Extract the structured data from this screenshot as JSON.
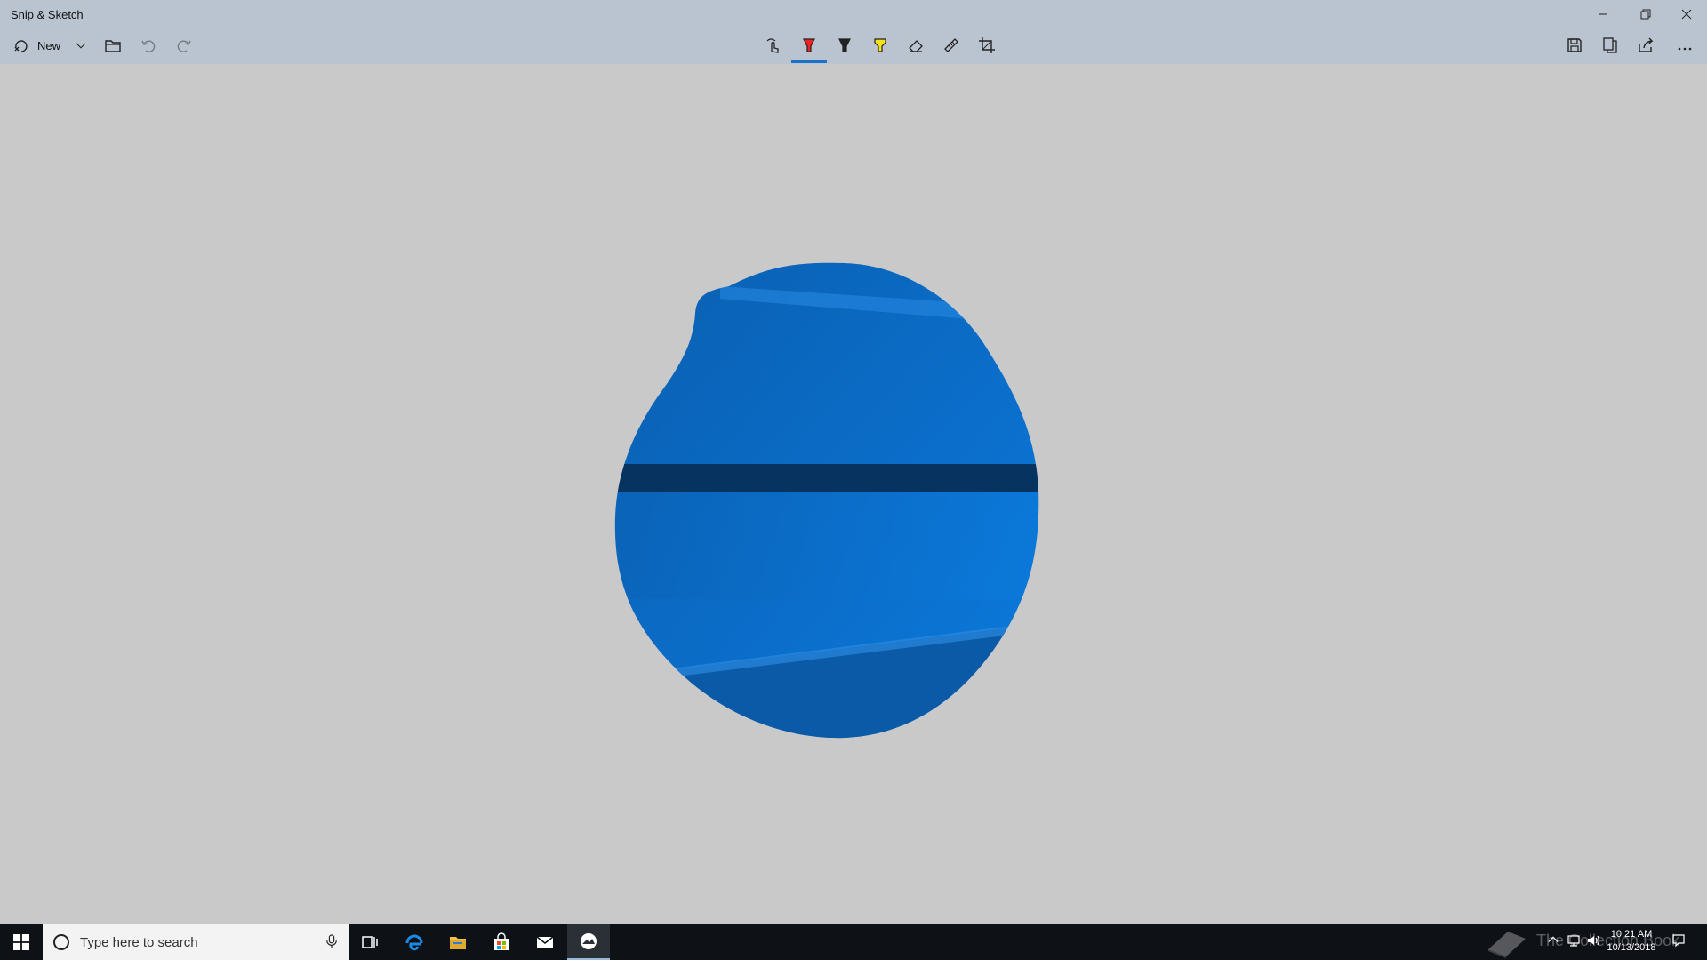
{
  "window": {
    "title": "Snip & Sketch",
    "controls": [
      "minimize-icon",
      "restore-icon",
      "close-icon"
    ]
  },
  "toolbar": {
    "new_label": "New",
    "left_icons": [
      "new-snip-icon",
      "chevron-down-icon",
      "folder-icon",
      "undo-icon",
      "redo-icon"
    ],
    "center_tools": [
      "touch-writing-icon",
      "ballpoint-pen-icon",
      "pencil-icon",
      "highlighter-icon",
      "eraser-icon",
      "ruler-icon",
      "crop-icon"
    ],
    "active_tool": "ballpoint-pen-icon",
    "right_icons": [
      "save-icon",
      "copy-icon",
      "share-icon",
      "more-icon"
    ],
    "accent_color": "#1a73c9"
  },
  "canvas": {
    "background_color": "#c9c9c9",
    "snip_content": "freeform-wallpaper-snip",
    "snip_colors": [
      "#0a5fb0",
      "#0b75d6",
      "#06335f"
    ]
  },
  "taskbar": {
    "search_placeholder": "Type here to search",
    "pinned_icons": [
      "task-view-icon",
      "edge-icon",
      "file-explorer-icon",
      "store-icon",
      "mail-icon",
      "snip-sketch-icon"
    ],
    "active_icon": "snip-sketch-icon",
    "watermark": "The Collection Book",
    "clock_time": "10:21 AM",
    "clock_date": "10/13/2018",
    "tray_icons": [
      "chevron-up-icon",
      "network-icon",
      "volume-icon",
      "notification-icon"
    ]
  }
}
